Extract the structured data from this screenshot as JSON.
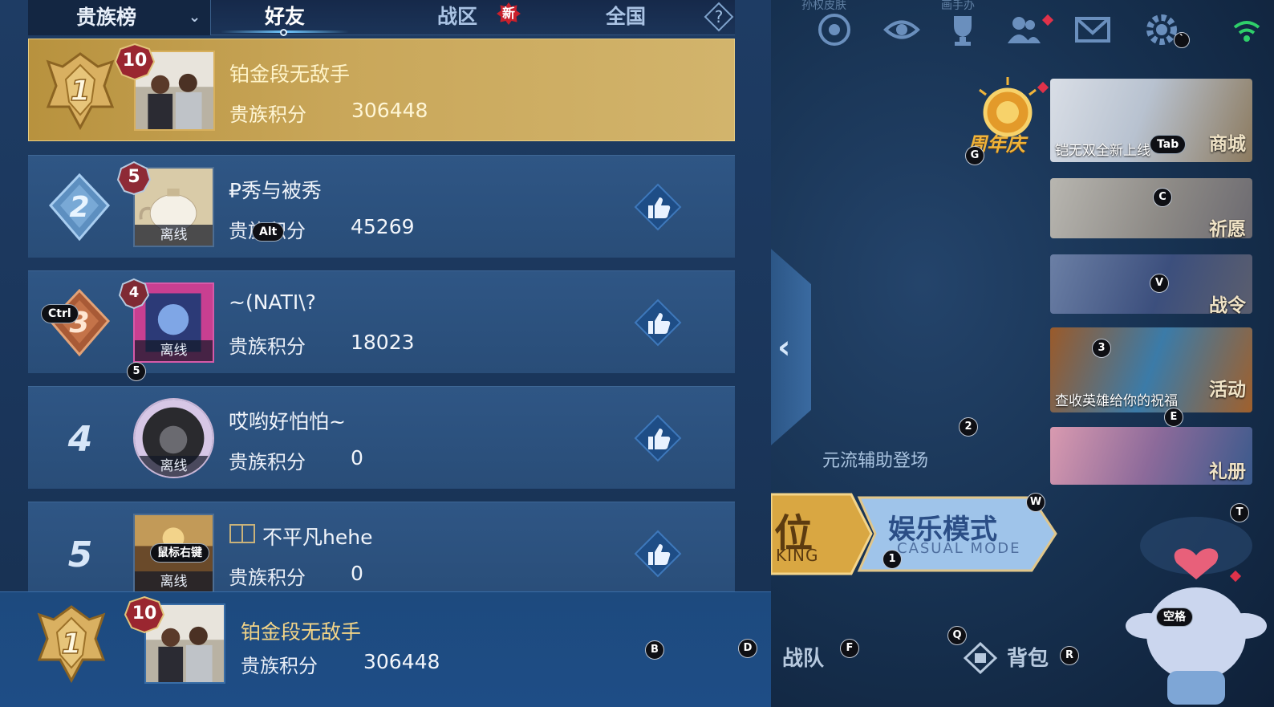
{
  "tabs": {
    "dropdown_label": "贵族榜",
    "items": [
      "好友",
      "战区",
      "全国"
    ],
    "new_badge": "新",
    "active": "好友"
  },
  "labels": {
    "score_label": "贵族积分",
    "offline": "离线"
  },
  "rows": [
    {
      "rank": "1",
      "level": "10",
      "name": "铂金段无敌手",
      "score": "306448",
      "offline": false,
      "highlight": true
    },
    {
      "rank": "2",
      "level": "5",
      "name": "₽秀与被秀",
      "score": "45269",
      "offline": true
    },
    {
      "rank": "3",
      "level": "4",
      "name": "~(NATI\\?",
      "score": "18023",
      "offline": true
    },
    {
      "rank": "4",
      "level": "",
      "name": "哎哟好怕怕~",
      "score": "0",
      "offline": true
    },
    {
      "rank": "5",
      "level": "",
      "name": "不平凡hehe",
      "score": "0",
      "offline": true
    }
  ],
  "self": {
    "rank": "1",
    "level": "10",
    "name": "铂金段无敌手",
    "score": "306448"
  },
  "key_hints": {
    "alt": "Alt",
    "ctrl": "Ctrl",
    "right_click": "鼠标右键",
    "tab": "Tab",
    "space": "空格",
    "five": "5",
    "b": "B",
    "d": "D",
    "g": "G",
    "c": "C",
    "v": "V",
    "three": "3",
    "e": "E",
    "two": "2",
    "w": "W",
    "t": "T",
    "one": "1",
    "f": "F",
    "q": "Q",
    "r": "R",
    "backtick": "`"
  },
  "right": {
    "top_labels": [
      "孙权皮肤",
      "画手办"
    ],
    "anniversary": "周年庆",
    "banners": [
      {
        "label": "商城",
        "caption": "铠无双全新上线"
      },
      {
        "label": "祈愿",
        "caption": ""
      },
      {
        "label": "战令",
        "caption": ""
      },
      {
        "label": "活动",
        "caption": "查收英雄给你的祝福"
      },
      {
        "label": "礼册",
        "caption": ""
      }
    ],
    "promo": "元流辅助登场",
    "mode_title": "娱乐模式",
    "mode_sub": "CASUAL MODE",
    "rank_char": "位",
    "rank_sub": "KING",
    "team": "战队",
    "bag": "背包"
  },
  "colors": {
    "gold_row": "#c9a75a",
    "panel": "#294d78",
    "accent_red": "#c8202c"
  }
}
